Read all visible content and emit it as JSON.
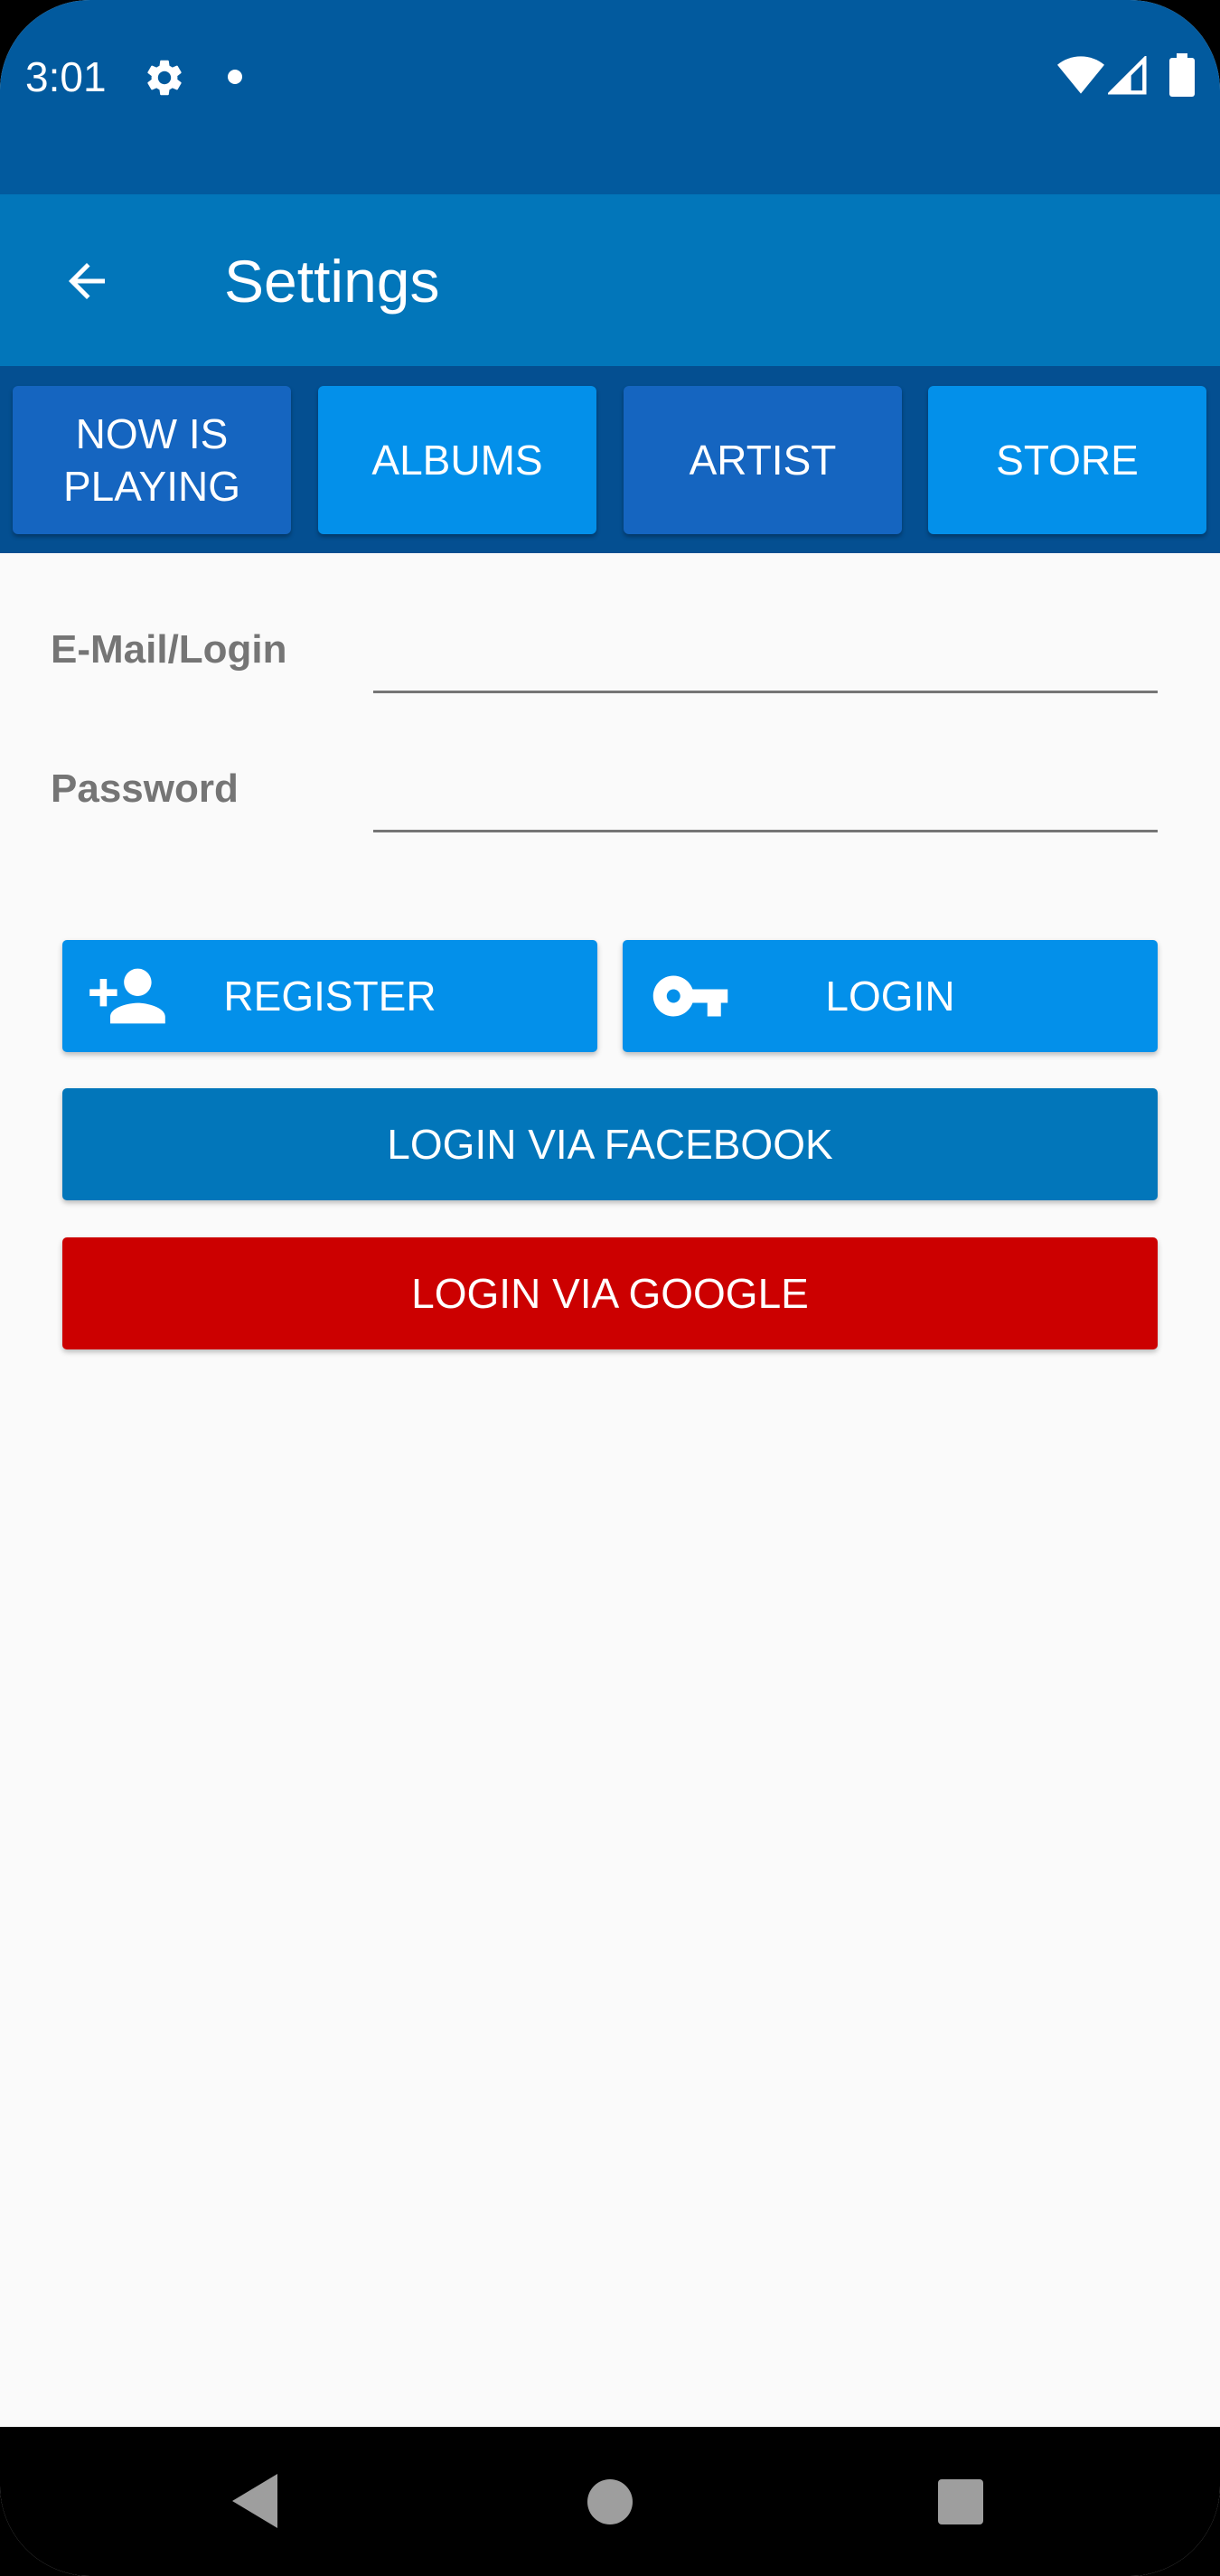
{
  "status_bar": {
    "time": "3:01",
    "icons": [
      "gear-icon",
      "notification-dot-icon",
      "wifi-icon",
      "signal-icon",
      "battery-icon"
    ]
  },
  "app_bar": {
    "title": "Settings",
    "back_icon": "back-arrow-icon"
  },
  "tabs": [
    {
      "label": "NOW IS PLAYING"
    },
    {
      "label": "ALBUMS"
    },
    {
      "label": "ARTIST"
    },
    {
      "label": "STORE"
    }
  ],
  "form": {
    "email_label": "E-Mail/Login",
    "email_value": "",
    "password_label": "Password",
    "password_value": ""
  },
  "buttons": {
    "register": "REGISTER",
    "login": "LOGIN",
    "facebook": "LOGIN VIA FACEBOOK",
    "google": "LOGIN VIA GOOGLE"
  },
  "colors": {
    "status_bar": "#025a9e",
    "app_bar": "#0276ba",
    "tabs_bg": "#044f91",
    "tab_dark": "#1565c0",
    "tab_light": "#0390ea",
    "button_blue": "#0390ea",
    "facebook": "#0276ba",
    "google": "#cc0000"
  },
  "nav_bar": {
    "icons": [
      "nav-back-icon",
      "nav-home-icon",
      "nav-recents-icon"
    ]
  }
}
